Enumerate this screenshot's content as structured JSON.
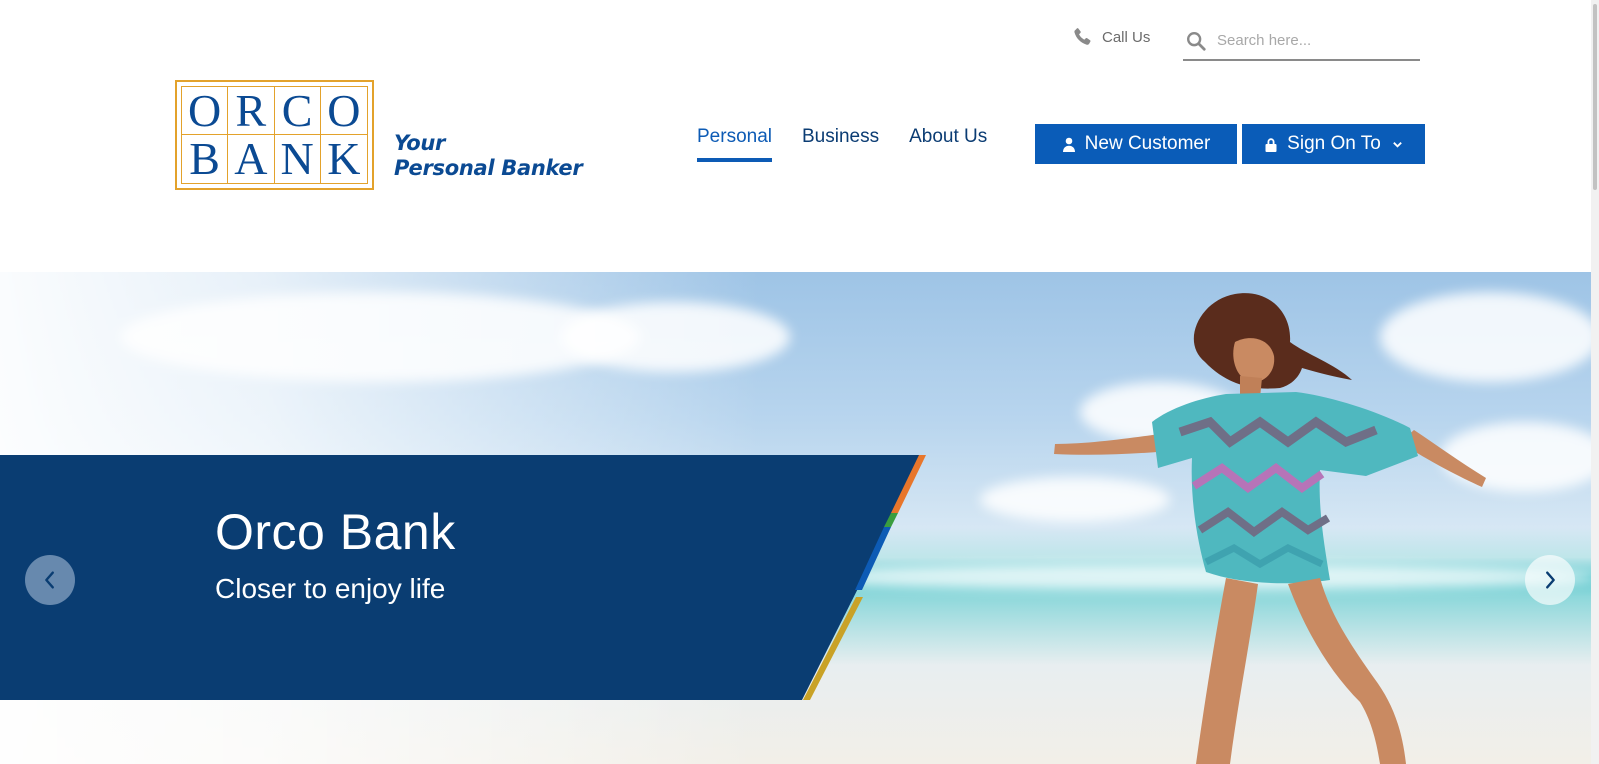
{
  "utility": {
    "call_label": "Call Us",
    "search_placeholder": "Search here..."
  },
  "logo": {
    "letters": [
      "O",
      "R",
      "C",
      "O",
      "B",
      "A",
      "N",
      "K"
    ],
    "tagline_line1": "Your",
    "tagline_line2": "Personal Banker"
  },
  "nav": {
    "items": [
      {
        "label": "Personal",
        "active": true
      },
      {
        "label": "Business",
        "active": false
      },
      {
        "label": "About Us",
        "active": false
      }
    ],
    "new_customer_label": "New Customer",
    "sign_on_label": "Sign On To"
  },
  "hero": {
    "title": "Orco Bank",
    "subtitle": "Closer to enjoy life"
  },
  "colors": {
    "brand_blue": "#0a3d72",
    "button_blue": "#0a5cb8",
    "logo_gold": "#e3a22b",
    "stripe_orange": "#e8762b",
    "stripe_green": "#3a9d3f",
    "stripe_blue": "#0d5bb5",
    "stripe_gold": "#c9a227"
  },
  "icons": {
    "phone": "phone-icon",
    "search": "search-icon",
    "user": "user-icon",
    "lock": "lock-icon",
    "chevron_down": "chevron-down-icon",
    "prev": "chevron-left-icon",
    "next": "chevron-right-icon"
  }
}
